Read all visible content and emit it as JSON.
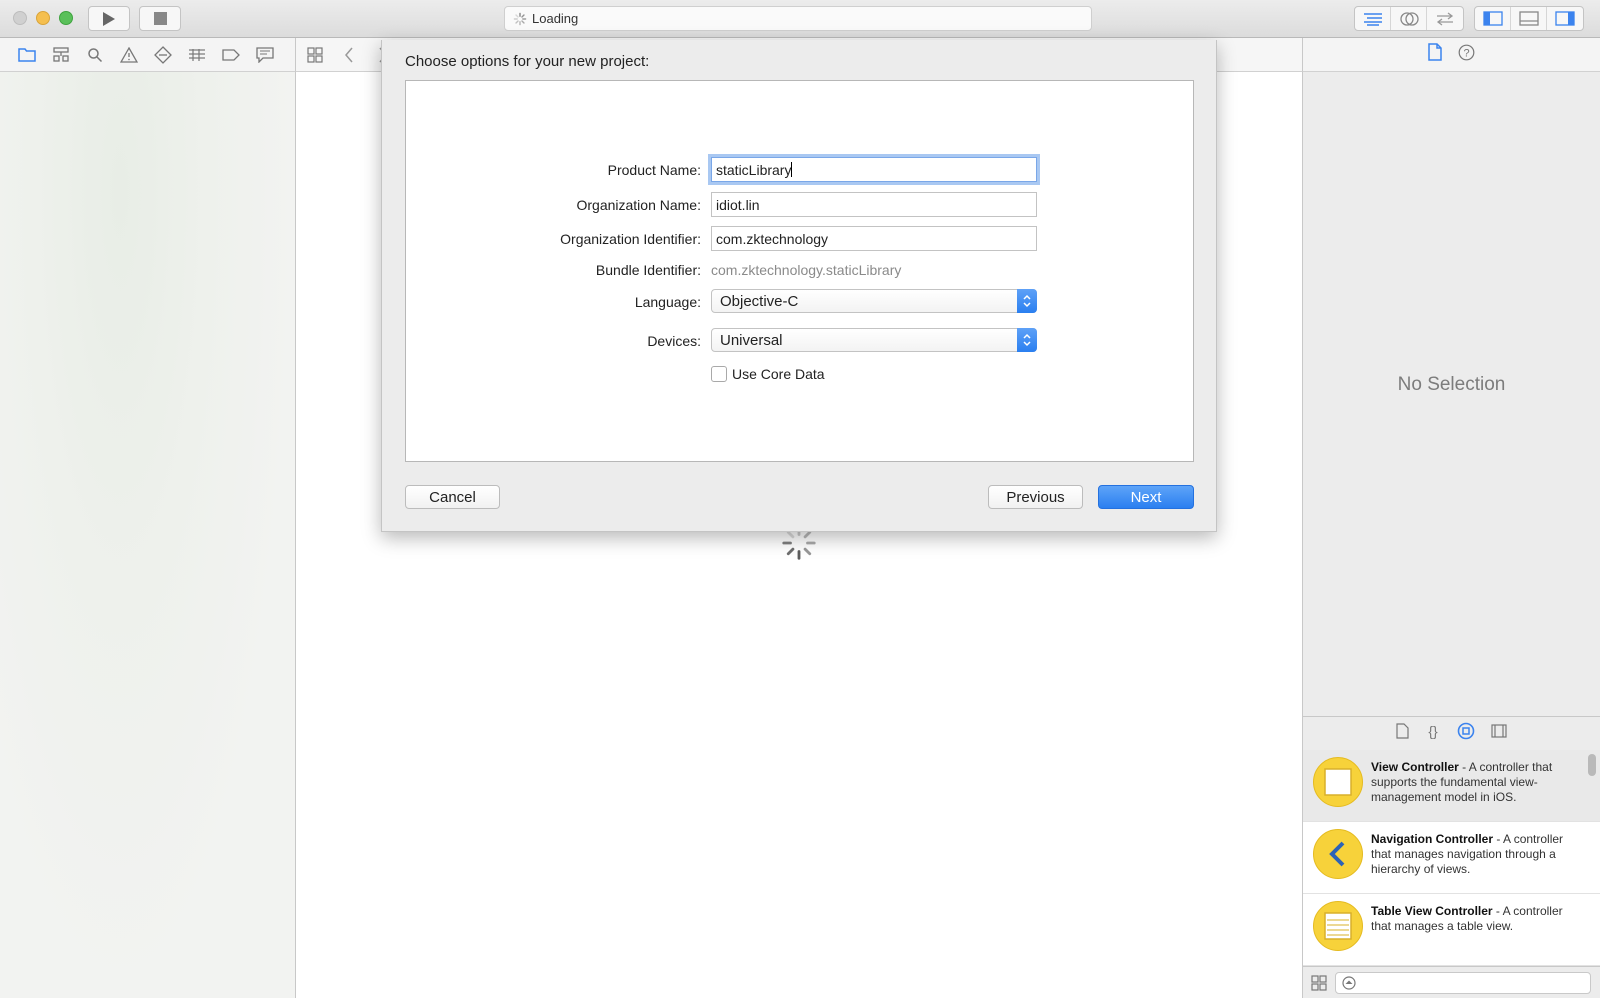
{
  "toolbar": {
    "activity_text": "Loading"
  },
  "dialog": {
    "title": "Choose options for your new project:",
    "fields": {
      "product_name": {
        "label": "Product Name:",
        "value": "staticLibrary"
      },
      "organization_name": {
        "label": "Organization Name:",
        "value": "idiot.lin"
      },
      "organization_identifier": {
        "label": "Organization Identifier:",
        "value": "com.zktechnology"
      },
      "bundle_identifier": {
        "label": "Bundle Identifier:",
        "value": "com.zktechnology.staticLibrary"
      },
      "language": {
        "label": "Language:",
        "value": "Objective-C"
      },
      "devices": {
        "label": "Devices:",
        "value": "Universal"
      },
      "use_core_data": {
        "label": "Use Core Data",
        "checked": false
      }
    },
    "buttons": {
      "cancel": "Cancel",
      "previous": "Previous",
      "next": "Next"
    }
  },
  "inspector": {
    "no_selection": "No Selection"
  },
  "library": {
    "items": [
      {
        "name": "View Controller",
        "description": " - A controller that supports the fundamental view-management model in iOS."
      },
      {
        "name": "Navigation Controller",
        "description": " - A controller that manages navigation through a hierarchy of views."
      },
      {
        "name": "Table View Controller",
        "description": " - A controller that manages a table view."
      }
    ]
  },
  "colors": {
    "accent": "#2b7ff0",
    "library_icon": "#f7d23a"
  }
}
